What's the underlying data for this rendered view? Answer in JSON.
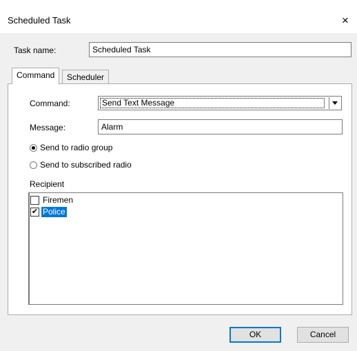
{
  "window": {
    "title": "Scheduled Task",
    "close_glyph": "×"
  },
  "task_name": {
    "label": "Task name:",
    "value": "Scheduled Task"
  },
  "tabs": [
    {
      "label": "Command",
      "active": true
    },
    {
      "label": "Scheduler",
      "active": false
    }
  ],
  "command": {
    "label": "Command:",
    "selected": "Send Text Message"
  },
  "message": {
    "label": "Message:",
    "value": "Alarm"
  },
  "radios": [
    {
      "label": "Send to radio group",
      "checked": true
    },
    {
      "label": "Send to subscribed radio",
      "checked": false
    }
  ],
  "recipient": {
    "label": "Recipient",
    "items": [
      {
        "label": "Firemen",
        "checked": false,
        "selected": false
      },
      {
        "label": "Police",
        "checked": true,
        "selected": true
      }
    ]
  },
  "buttons": {
    "ok": "OK",
    "cancel": "Cancel"
  },
  "colors": {
    "selection": "#0078d7",
    "dialog_bg": "#f0f0f0"
  },
  "icons": {
    "close": "close-icon",
    "dropdown": "chevron-down-icon"
  }
}
